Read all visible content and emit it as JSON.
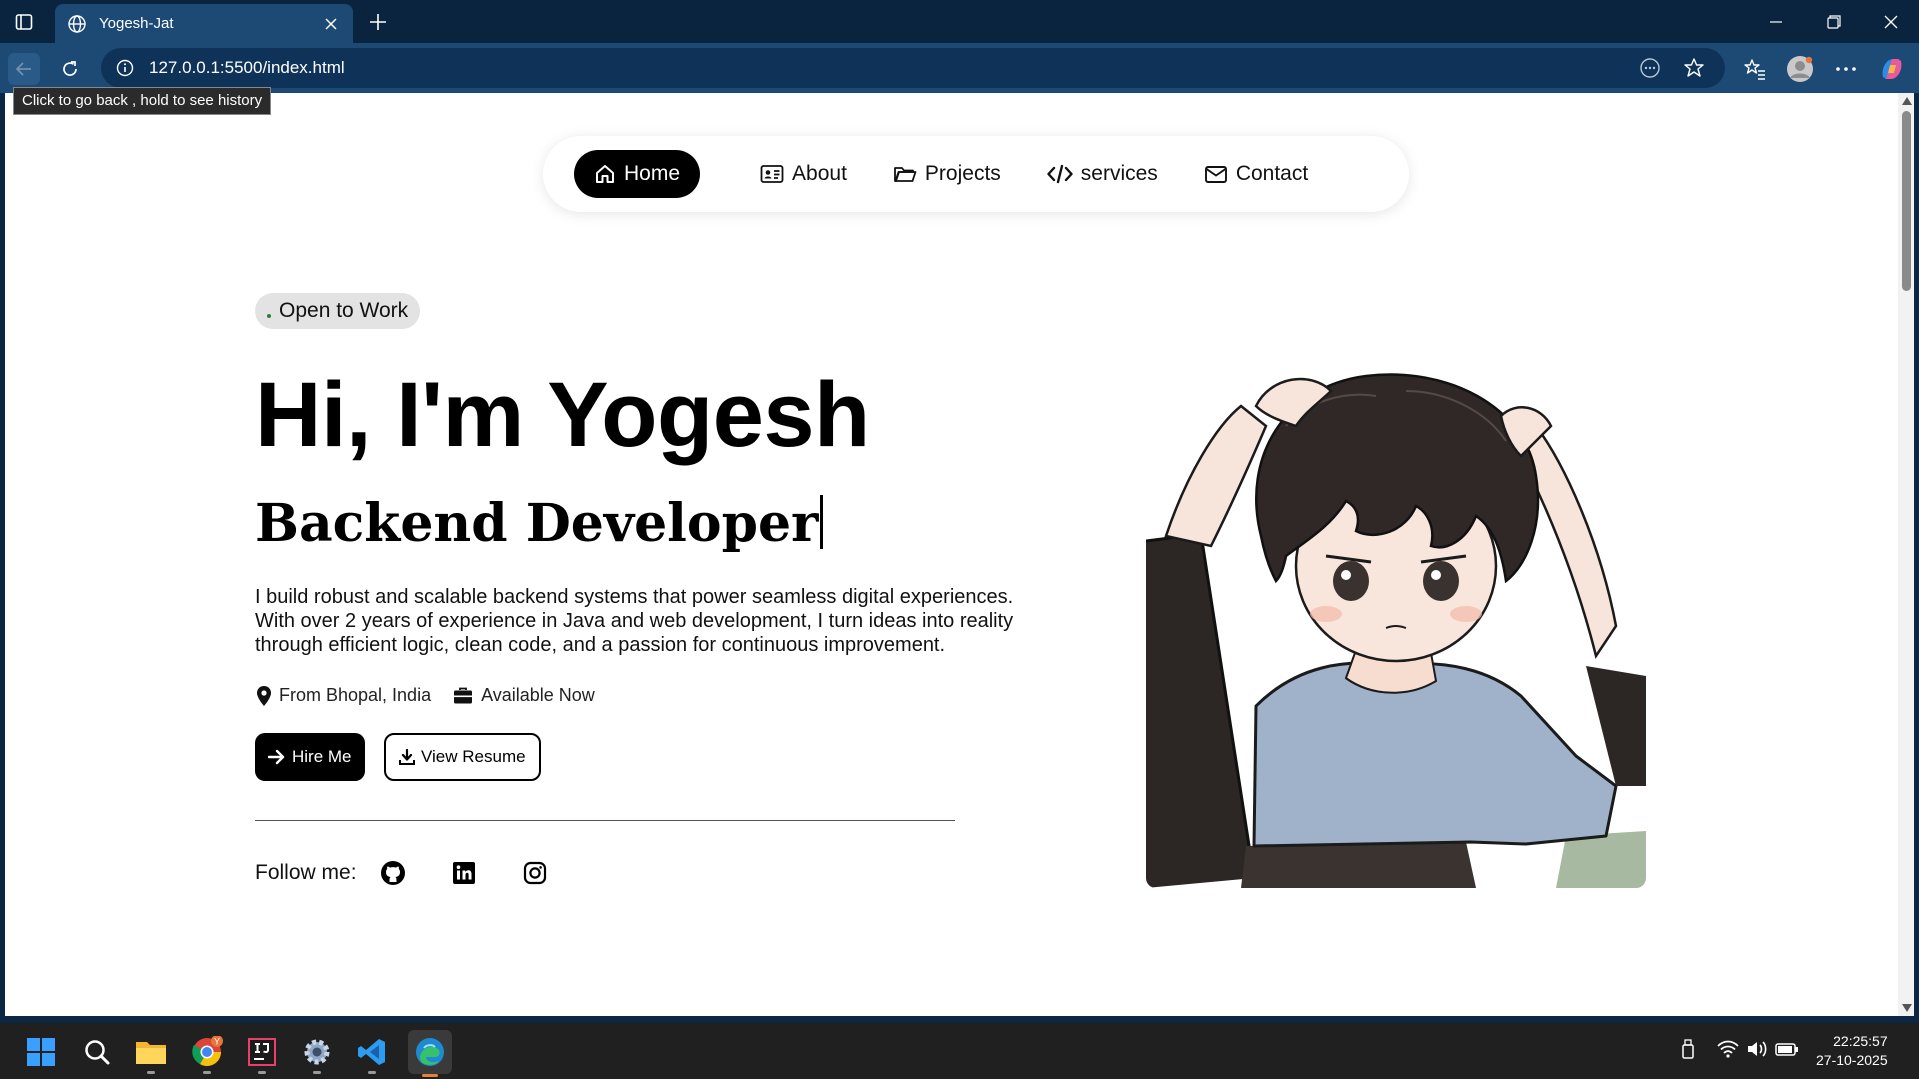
{
  "browser": {
    "tab_title": "Yogesh-Jat",
    "address": "127.0.0.1:5500/index.html",
    "tooltip": "Click to go back , hold to see history"
  },
  "nav": {
    "items": [
      {
        "label": "Home",
        "icon": "home-icon",
        "active": true
      },
      {
        "label": "About",
        "icon": "id-card-icon"
      },
      {
        "label": "Projects",
        "icon": "folder-icon"
      },
      {
        "label": "services",
        "icon": "code-icon"
      },
      {
        "label": "Contact",
        "icon": "envelope-icon"
      }
    ]
  },
  "hero": {
    "badge": "Open to Work",
    "badge_dot": ".",
    "title": "Hi, I'm Yogesh",
    "role": "Backend Developer",
    "description": "I build robust and scalable backend systems that power seamless digital experiences. With over 2 years of experience in Java and web development, I turn ideas into reality through efficient logic, clean code, and a passion for continuous improvement.",
    "location": "From Bhopal, India",
    "availability": "Available Now",
    "hire_label": "Hire Me",
    "resume_label": "View Resume",
    "follow_label": "Follow me:",
    "socials": [
      "github-icon",
      "linkedin-icon",
      "instagram-icon"
    ]
  },
  "taskbar": {
    "time": "22:25:57",
    "date": "27-10-2025",
    "chrome_badge": "Y"
  },
  "colors": {
    "titlebar": "#0a2440",
    "toolbar": "#1c4a75",
    "accent": "#000000",
    "badge_bg": "#e3e3e3"
  }
}
